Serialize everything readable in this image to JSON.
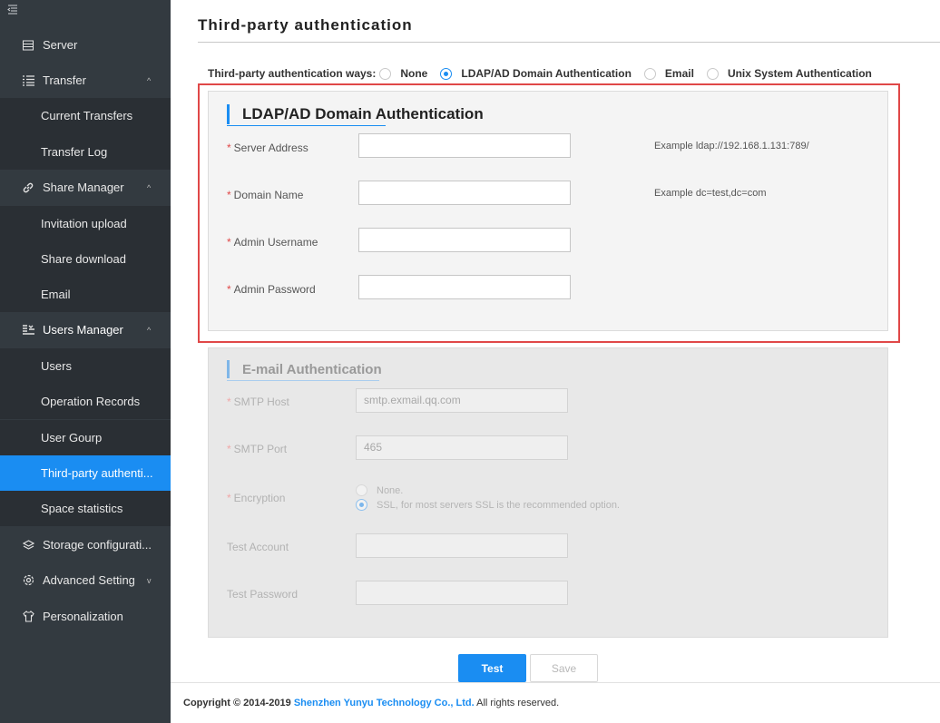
{
  "sidebar": {
    "collapse_icon": "menu-collapse-icon",
    "groups": {
      "server": {
        "label": "Server",
        "icon": "server-icon"
      },
      "transfer": {
        "label": "Transfer",
        "icon": "list-icon",
        "chevron": "^"
      },
      "share": {
        "label": "Share Manager",
        "icon": "link-icon",
        "chevron": "^"
      },
      "users": {
        "label": "Users Manager",
        "icon": "users-icon",
        "chevron": "^"
      },
      "storage": {
        "label": "Storage configurati...",
        "icon": "layers-icon"
      },
      "advanced": {
        "label": "Advanced Setting",
        "icon": "gear-icon",
        "chevron": "v"
      },
      "personal": {
        "label": "Personalization",
        "icon": "shirt-icon"
      }
    },
    "items": {
      "current_transfers": "Current Transfers",
      "transfer_log": "Transfer Log",
      "invitation_upload": "Invitation upload",
      "share_download": "Share download",
      "email": "Email",
      "users": "Users",
      "operation_records": "Operation Records",
      "user_group": "User Gourp",
      "third_party": "Third-party authenti...",
      "space_statistics": "Space statistics"
    }
  },
  "page": {
    "title": "Third-party authentication",
    "ways_label": "Third-party authentication ways:",
    "ways": [
      "None",
      "LDAP/AD Domain Authentication",
      "Email",
      "Unix System Authentication"
    ],
    "selected_way": "LDAP/AD Domain Authentication"
  },
  "ldap": {
    "heading": "LDAP/AD Domain Authentication",
    "required_mark": "*",
    "server_address_label": "Server Address",
    "domain_name_label": "Domain Name",
    "admin_username_label": "Admin Username",
    "admin_password_label": "Admin Password",
    "server_address_example": "Example ldap://192.168.1.131:789/",
    "domain_name_example": "Example dc=test,dc=com"
  },
  "email_auth": {
    "heading": "E-mail Authentication",
    "required_mark": "*",
    "smtp_host_label": "SMTP Host",
    "smtp_host_value": "smtp.exmail.qq.com",
    "smtp_port_label": "SMTP Port",
    "smtp_port_value": "465",
    "encryption_label": "Encryption",
    "encryption_none": "None.",
    "encryption_ssl": "SSL, for most servers SSL is the recommended option.",
    "test_account_label": "Test Account",
    "test_password_label": "Test Password"
  },
  "actions": {
    "test": "Test",
    "save": "Save"
  },
  "footer": {
    "prefix": "Copyright © 2014-2019",
    "company": "Shenzhen Yunyu Technology Co., Ltd.",
    "suffix": "All rights reserved."
  },
  "colors": {
    "accent": "#1a8df2",
    "sidebar": "#333a40",
    "highlight": "#e04848"
  }
}
